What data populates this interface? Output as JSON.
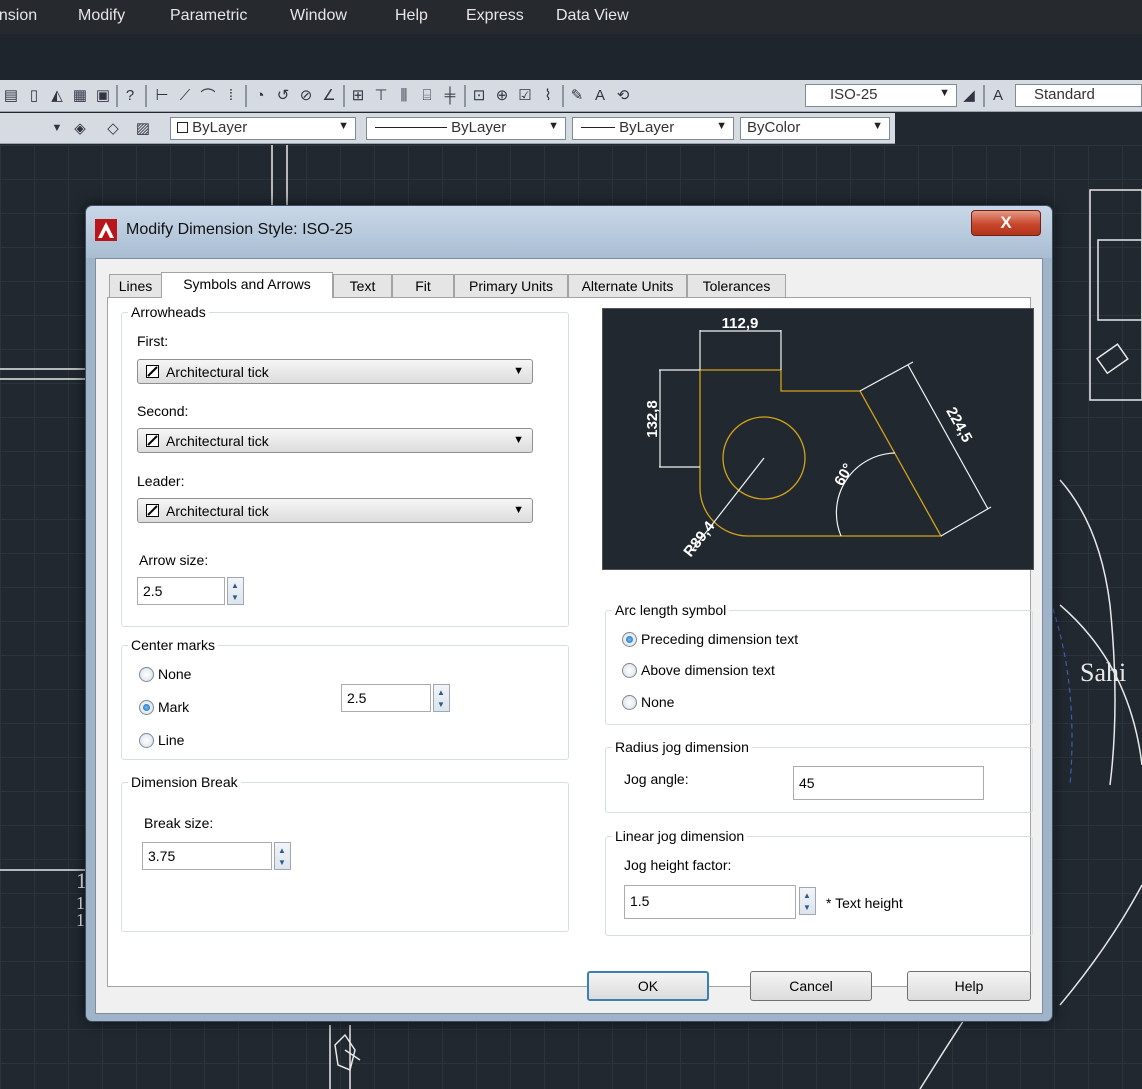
{
  "menubar": {
    "items": [
      "ension",
      "Modify",
      "Parametric",
      "Window",
      "Help",
      "Express",
      "Data View"
    ]
  },
  "toolbar": {
    "dimstyle_combo": "ISO-25",
    "textstyle_combo": "Standard",
    "color_combo": "ByLayer",
    "linetype_combo": "ByLayer",
    "lineweight_combo": "ByLayer",
    "plotstyle_combo": "ByColor"
  },
  "background": {
    "side_label": "Sahi",
    "digit_top": "1",
    "digit_mid": "1",
    "digit_bot": "1"
  },
  "dialog": {
    "title": "Modify Dimension Style: ISO-25",
    "close_glyph": "X",
    "tabs": [
      "Lines",
      "Symbols and Arrows",
      "Text",
      "Fit",
      "Primary Units",
      "Alternate Units",
      "Tolerances"
    ],
    "active_tab": "Symbols and Arrows",
    "arrowheads": {
      "legend": "Arrowheads",
      "first_label": "First:",
      "first_value": "Architectural tick",
      "second_label": "Second:",
      "second_value": "Architectural tick",
      "leader_label": "Leader:",
      "leader_value": "Architectural tick",
      "arrow_size_label": "Arrow size:",
      "arrow_size_value": "2.5"
    },
    "center_marks": {
      "legend": "Center marks",
      "options": [
        "None",
        "Mark",
        "Line"
      ],
      "selected": "Mark",
      "size_value": "2.5"
    },
    "dimension_break": {
      "legend": "Dimension Break",
      "break_size_label": "Break size:",
      "break_size_value": "3.75"
    },
    "preview": {
      "dim_top": "112,9",
      "dim_left": "132,8",
      "dim_right": "224,5",
      "dim_angle": "60°",
      "dim_radius": "R89,4"
    },
    "arc_length_symbol": {
      "legend": "Arc length symbol",
      "options": [
        "Preceding dimension text",
        "Above dimension text",
        "None"
      ],
      "selected": "Preceding dimension text"
    },
    "radius_jog": {
      "legend": "Radius jog dimension",
      "jog_angle_label": "Jog angle:",
      "jog_angle_value": "45"
    },
    "linear_jog": {
      "legend": "Linear jog dimension",
      "jog_height_label": "Jog height factor:",
      "jog_height_value": "1.5",
      "suffix": "* Text height"
    },
    "buttons": {
      "ok": "OK",
      "cancel": "Cancel",
      "help": "Help"
    }
  }
}
